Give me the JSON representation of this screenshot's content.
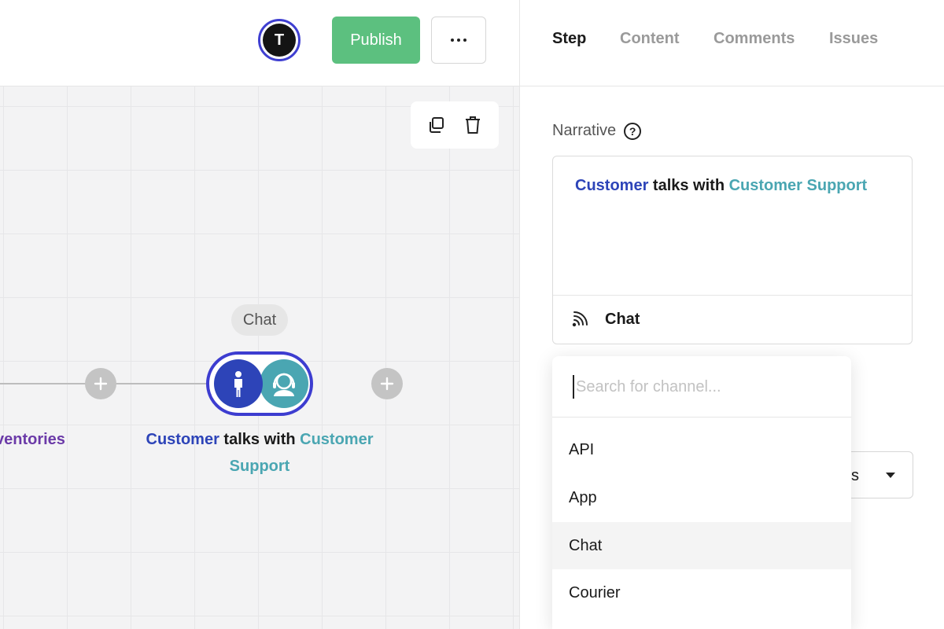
{
  "topbar": {
    "avatar_initial": "T",
    "publish_label": "Publish"
  },
  "canvas": {
    "left_node_caption": "ventories",
    "edge_chip": "Chat",
    "node_caption": {
      "actor": "Customer",
      "verb": " talks with ",
      "target": "Customer Support"
    }
  },
  "panel": {
    "tabs": [
      {
        "label": "Step",
        "active": true
      },
      {
        "label": "Content",
        "active": false
      },
      {
        "label": "Comments",
        "active": false
      },
      {
        "label": "Issues",
        "active": false
      }
    ],
    "narrative": {
      "label": "Narrative",
      "help": "?",
      "actor": "Customer",
      "verb": " talks with ",
      "target": "Customer Support",
      "channel": "Chat"
    },
    "behind_select_value": "s",
    "dropdown": {
      "search_placeholder": "Search for channel...",
      "search_value": "",
      "options": [
        "API",
        "App",
        "Chat",
        "Courier"
      ],
      "hovered": "Chat"
    }
  },
  "colors": {
    "actor_blue": "#2d44b8",
    "target_teal": "#4aa6b2",
    "publish_green": "#5cc07f",
    "node_border": "#3d3dd0",
    "left_caption_purple": "#6b3aa8"
  }
}
